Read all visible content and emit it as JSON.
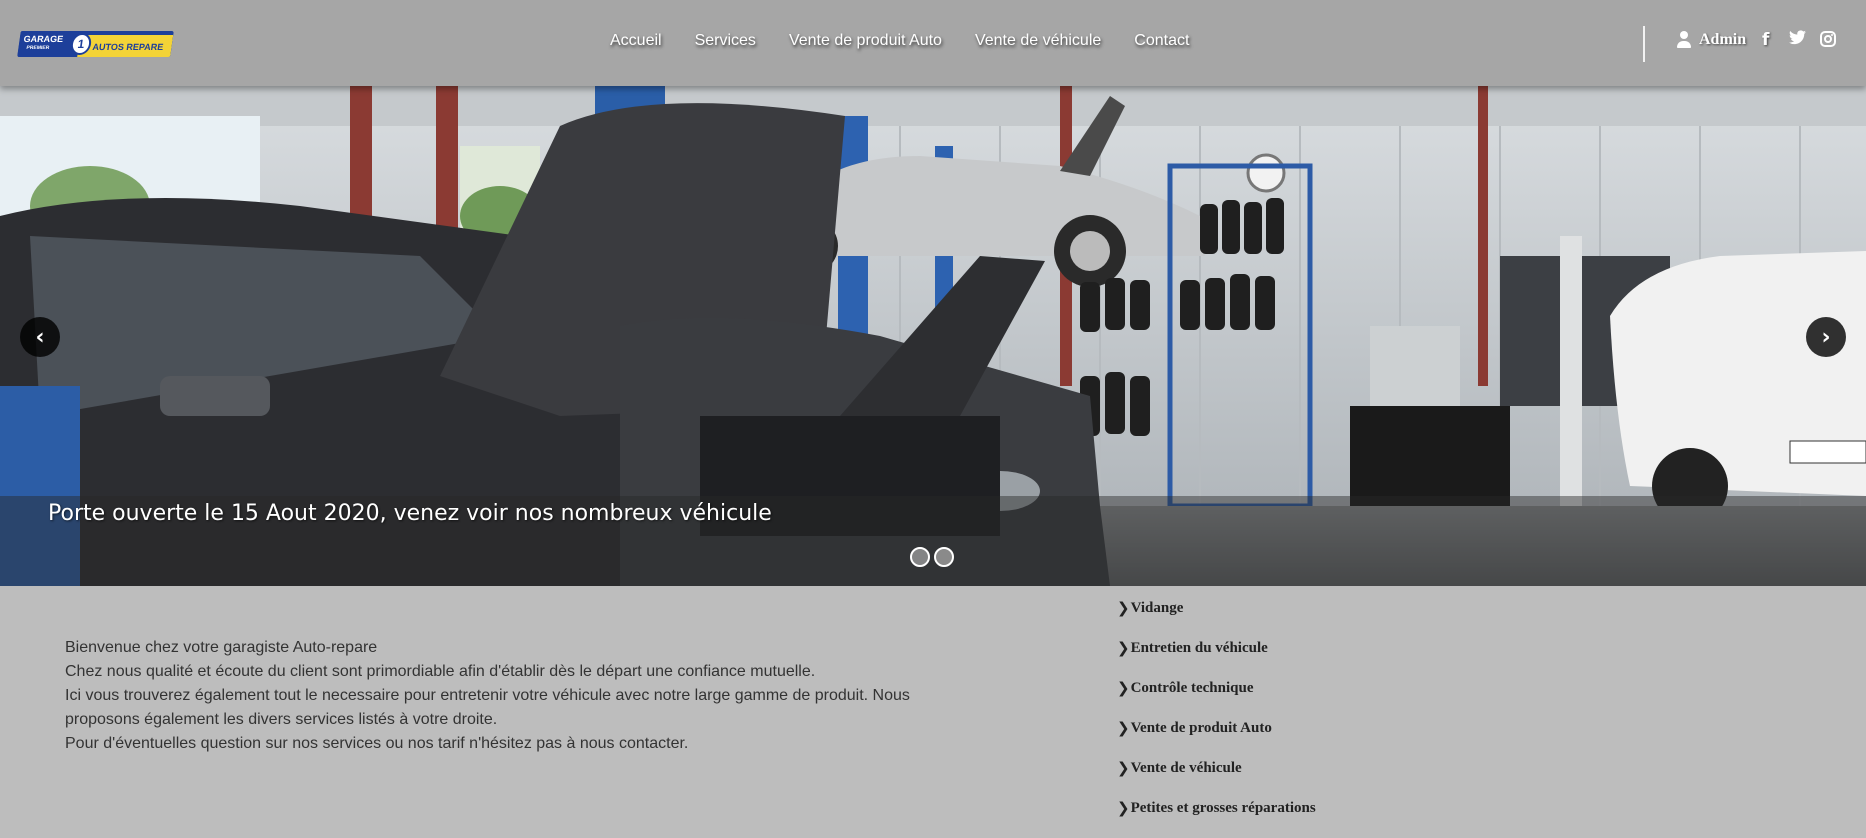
{
  "header": {
    "logo_text_1": "GARAGE",
    "logo_text_2": "PREMIER",
    "logo_text_3": "AUTOS REPARE",
    "logo_number": "1",
    "nav": [
      "Accueil",
      "Services",
      "Vente de produit Auto",
      "Vente de véhicule",
      "Contact"
    ],
    "admin_label": "Admin",
    "social_glyphs": [
      "f",
      "t",
      "◎"
    ],
    "social_icons": [
      "facebook-icon",
      "twitter-icon",
      "instagram-icon"
    ]
  },
  "carousel": {
    "caption": "Porte ouverte le 15 Aout 2020, venez voir nos nombreux véhicule",
    "prev_glyph": "‹",
    "next_glyph": "›",
    "slides_count": 2,
    "active_slide": 2
  },
  "welcome": {
    "lines": [
      "Bienvenue chez votre garagiste Auto-repare",
      "Chez nous qualité et écoute du client sont primordiable afin d'établir dès le départ une confiance mutuelle.",
      "Ici vous trouverez également tout le necessaire pour entretenir votre véhicule avec notre large gamme de produit. Nous proposons également les divers services listés à votre droite.",
      "Pour d'éventuelles question sur nos services ou nos tarif n'hésitez pas à nous contacter."
    ]
  },
  "services": {
    "chevron": "❯",
    "items": [
      "Vidange",
      "Entretien du véhicule",
      "Contrôle technique",
      "Vente de produit Auto",
      "Vente de véhicule",
      "Petites et grosses réparations"
    ]
  },
  "colors": {
    "header_bg": "#a6a6a6",
    "page_bg": "#bdbdbd",
    "logo_blue": "#1d3f9a",
    "logo_yellow": "#f3d337"
  }
}
